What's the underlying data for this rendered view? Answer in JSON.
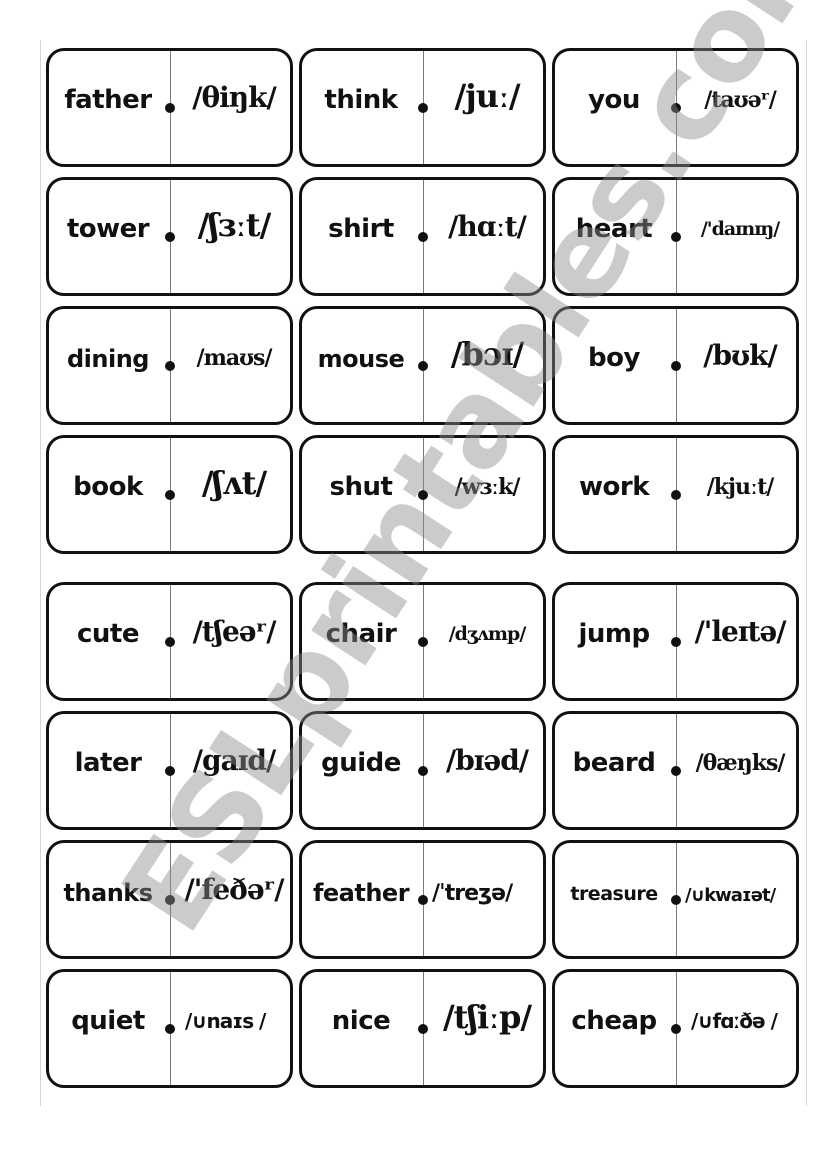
{
  "document": {
    "watermark": "ESLprintables.com",
    "panels": [
      {
        "cards": [
          {
            "word": "father",
            "ipa": "/θiŋk/"
          },
          {
            "word": "think",
            "ipa": "/juː/"
          },
          {
            "word": "you",
            "ipa": "/taʊəʳ/"
          },
          {
            "word": "tower",
            "ipa": "/ʃɜːt/"
          },
          {
            "word": "shirt",
            "ipa": "/hɑːt/"
          },
          {
            "word": "heart",
            "ipa": "/'daɪnɪŋ/"
          },
          {
            "word": "dining",
            "ipa": "/maʊs/"
          },
          {
            "word": "mouse",
            "ipa": "/bɔɪ/"
          },
          {
            "word": "boy",
            "ipa": "/bʊk/"
          },
          {
            "word": "book",
            "ipa": "/ʃʌt/"
          },
          {
            "word": "shut",
            "ipa": "/wɜːk/"
          },
          {
            "word": "work",
            "ipa": "/kjuːt/"
          }
        ]
      },
      {
        "cards": [
          {
            "word": "cute",
            "ipa": "/tʃeəʳ/"
          },
          {
            "word": "chair",
            "ipa": "/dʒʌmp/"
          },
          {
            "word": "jump",
            "ipa": "/'leɪtə/"
          },
          {
            "word": "later",
            "ipa": "/gaɪd/"
          },
          {
            "word": "guide",
            "ipa": "/bɪəd/"
          },
          {
            "word": "beard",
            "ipa": "/θæŋks/"
          },
          {
            "word": "thanks",
            "ipa": "/'feðəʳ/"
          },
          {
            "word": "feather",
            "ipa": "/ˈtreʒə/"
          },
          {
            "word": "treasure",
            "ipa": "/∪kwaɪət/"
          },
          {
            "word": "quiet",
            "ipa": "/∪naɪs /"
          },
          {
            "word": "nice",
            "ipa": "/tʃiːp/"
          },
          {
            "word": "cheap",
            "ipa": "/∪fɑːðə /"
          }
        ]
      }
    ]
  }
}
